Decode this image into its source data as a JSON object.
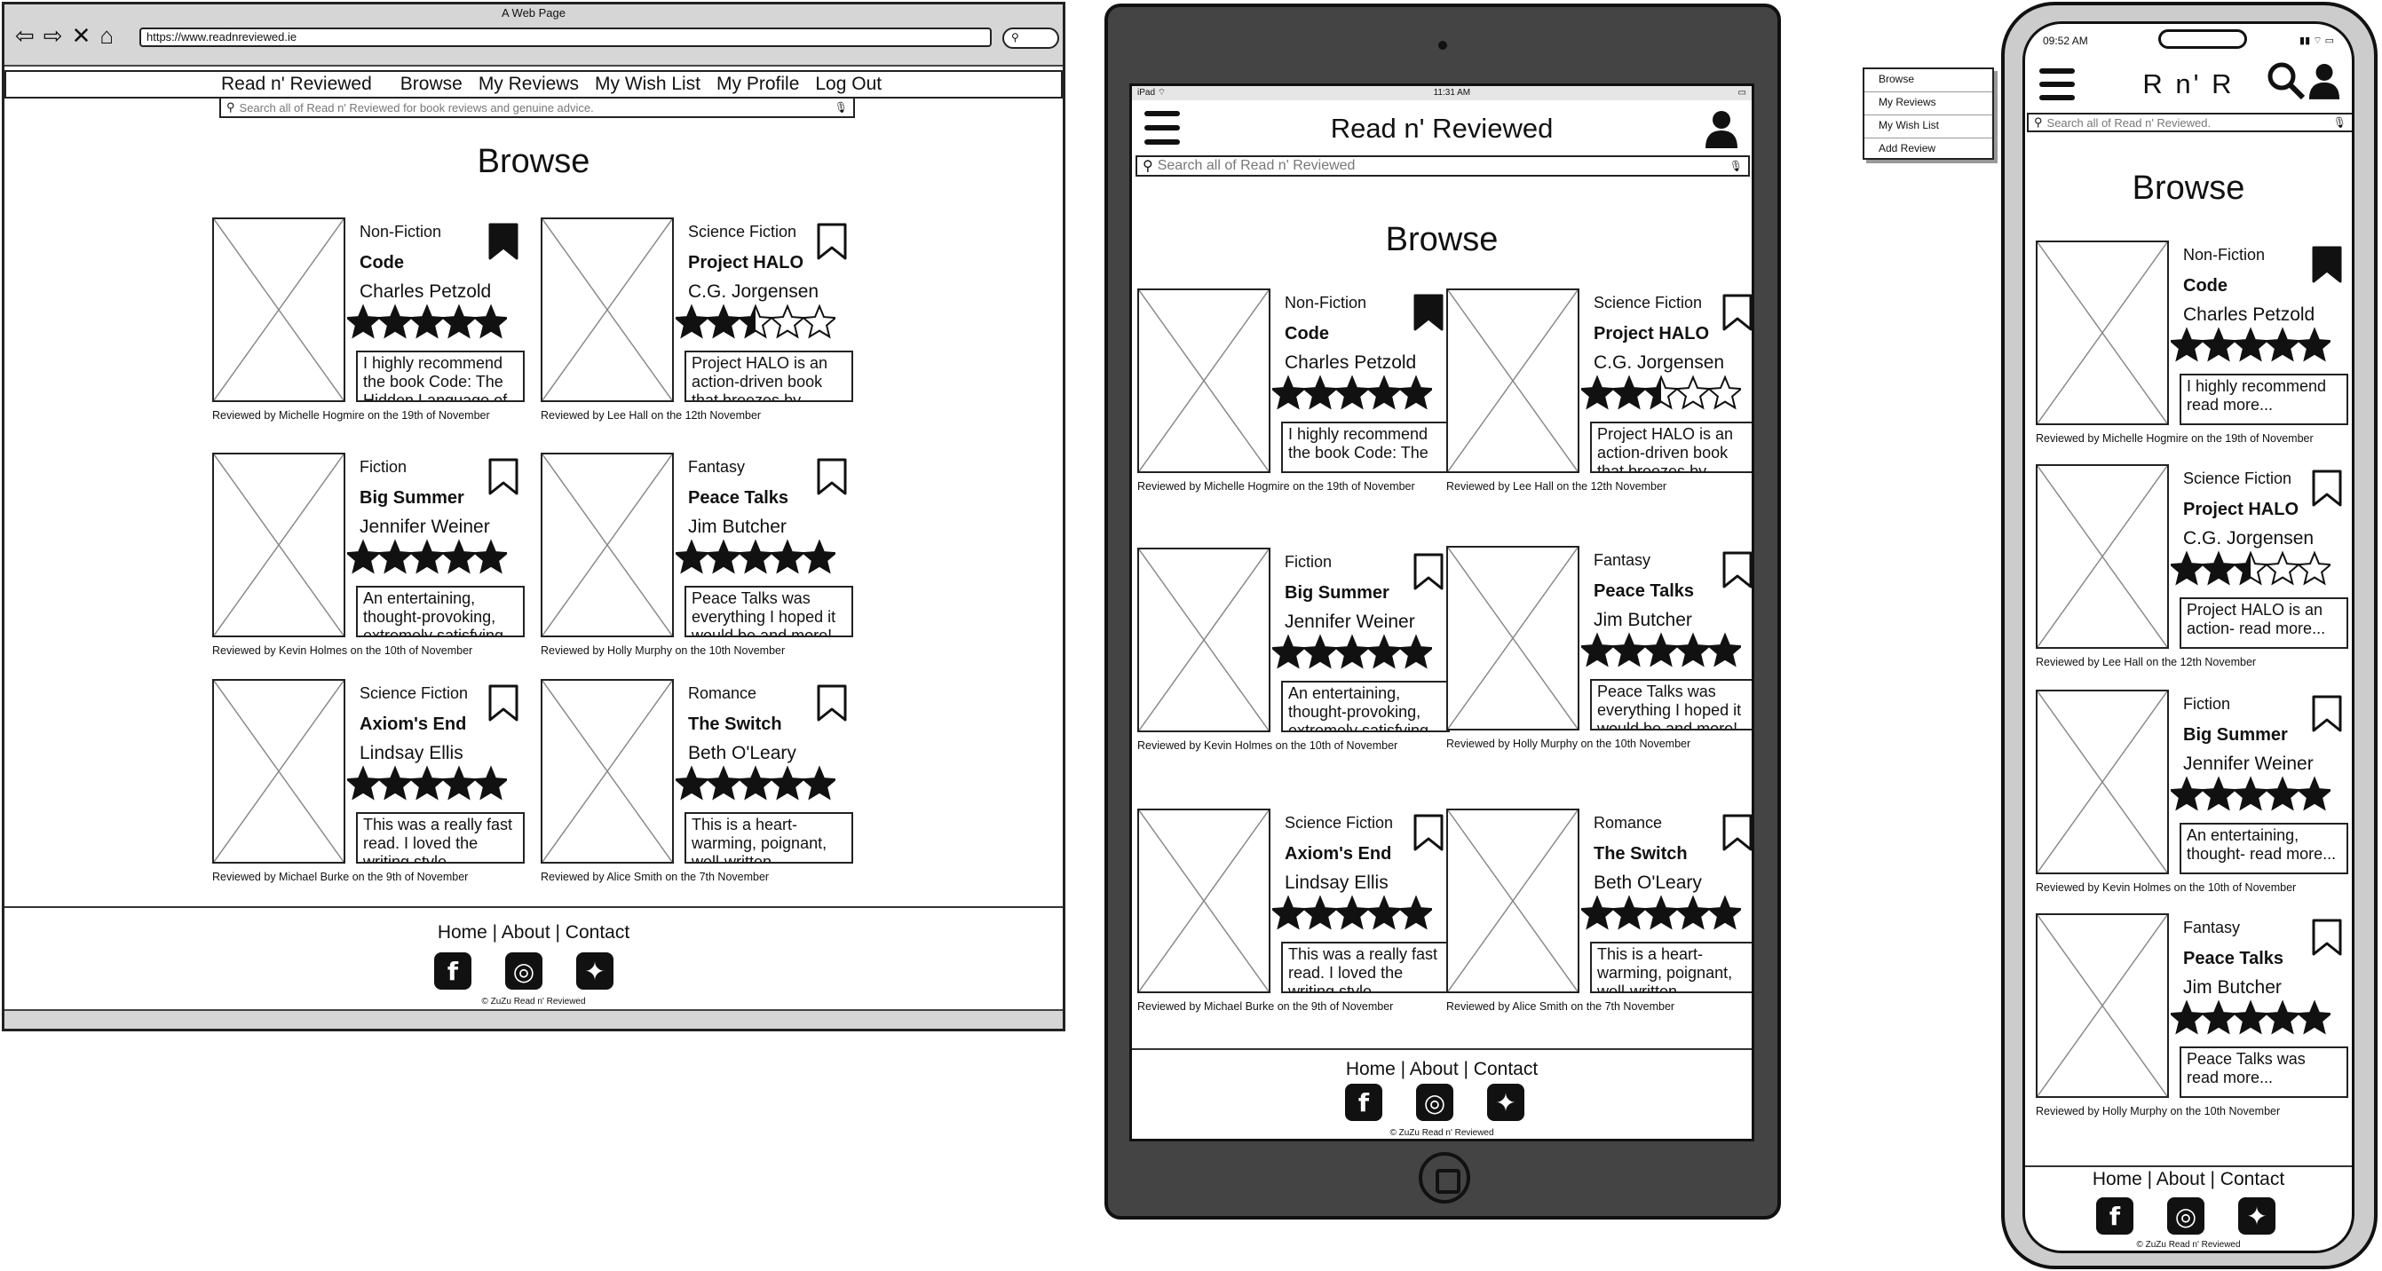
{
  "desktop": {
    "window_title": "A Web Page",
    "nav_buttons": [
      "⇦",
      "⇨",
      "✕",
      "⌂"
    ],
    "url": "https://www.readnreviewed.ie",
    "brand": "Read n' Reviewed",
    "nav_links": [
      "Browse",
      "My Reviews",
      "My Wish List",
      "My Profile",
      "Log Out"
    ],
    "search_placeholder": "Search all of Read n' Reviewed for book reviews and genuine advice.",
    "heading": "Browse",
    "cards": [
      {
        "genre": "Non-Fiction",
        "title": "Code",
        "author": "Charles Petzold",
        "rating": 5,
        "bookmarked": true,
        "review": "I highly recommend the book Code: The Hidden Language of",
        "byline": "Reviewed by Michelle Hogmire on the 19th of November"
      },
      {
        "genre": "Science Fiction",
        "title": "Project HALO",
        "author": "C.G. Jorgensen",
        "rating": 2.5,
        "bookmarked": false,
        "review": "Project HALO is an action-driven book that breezes by",
        "byline": "Reviewed by Lee Hall on the 12th November"
      },
      {
        "genre": "Fiction",
        "title": "Big Summer",
        "author": "Jennifer Weiner",
        "rating": 5,
        "bookmarked": false,
        "review": "An entertaining, thought-provoking, extremely satisfying",
        "byline": "Reviewed by Kevin Holmes on the 10th of November"
      },
      {
        "genre": "Fantasy",
        "title": "Peace Talks",
        "author": "Jim Butcher",
        "rating": 5,
        "bookmarked": false,
        "review": "Peace Talks was everything I hoped it would be and more!",
        "byline": "Reviewed by Holly Murphy on the 10th November"
      },
      {
        "genre": "Science Fiction",
        "title": "Axiom's End",
        "author": "Lindsay Ellis",
        "rating": 5,
        "bookmarked": false,
        "review": "This was a really fast read.  I loved the writing style",
        "byline": "Reviewed by Michael Burke on the 9th of November"
      },
      {
        "genre": "Romance",
        "title": "The Switch",
        "author": "Beth O'Leary",
        "rating": 5,
        "bookmarked": false,
        "review": "This is a heart-warming, poignant, well-written",
        "byline": "Reviewed by Alice Smith on the 7th November"
      }
    ],
    "footer_links": "Home  |  About  |  Contact",
    "copyright": "© ZuZu Read n' Reviewed"
  },
  "tablet": {
    "status_left": "iPad ⌔",
    "status_time": "11:31 AM",
    "status_right": "▭",
    "title": "Read n' Reviewed",
    "search_placeholder": "Search all of Read n' Reviewed",
    "heading": "Browse",
    "cards": [
      {
        "genre": "Non-Fiction",
        "title": "Code",
        "author": "Charles Petzold",
        "review": "I highly recommend the book Code: The",
        "byline": "Reviewed by Michelle Hogmire on the 19th of November"
      },
      {
        "genre": "Science Fiction",
        "title": "Project HALO",
        "author": "C.G. Jorgensen",
        "review": "Project HALO is an action-driven book that breezes by",
        "byline": "Reviewed by Lee Hall on the 12th November"
      },
      {
        "genre": "Fiction",
        "title": "Big Summer",
        "author": "Jennifer Weiner",
        "review": "An entertaining, thought-provoking, extremely satisfying",
        "byline": "Reviewed by Kevin Holmes on the 10th of November"
      },
      {
        "genre": "Fantasy",
        "title": "Peace Talks",
        "author": "Jim Butcher",
        "review": "Peace Talks was everything I hoped it would be and more!",
        "byline": "Reviewed by Holly Murphy on the 10th November"
      },
      {
        "genre": "Science Fiction",
        "title": "Axiom's End",
        "author": "Lindsay Ellis",
        "review": "This was a really fast read.  I loved the writing style",
        "byline": "Reviewed by Michael Burke on the 9th of November"
      },
      {
        "genre": "Romance",
        "title": "The Switch",
        "author": "Beth O'Leary",
        "review": "This is a heart-warming, poignant, well-written",
        "byline": "Reviewed by Alice Smith on the 7th November"
      }
    ],
    "footer_links": "Home  |  About  |  Contact",
    "copyright": "© ZuZu Read n' Reviewed"
  },
  "dropdown": [
    "Browse",
    "My Reviews",
    "My Wish List",
    "Add Review"
  ],
  "phone": {
    "status_time": "09:52 AM",
    "status_right": "▮▮ ⌔ ▭",
    "title": "R n' R",
    "search_placeholder": "Search all of Read n' Reviewed.",
    "heading": "Browse",
    "cards": [
      {
        "genre": "Non-Fiction",
        "title": "Code",
        "author": "Charles Petzold",
        "review": "I highly recommend read more...",
        "byline": "Reviewed by Michelle Hogmire on the 19th of November"
      },
      {
        "genre": "Science Fiction",
        "title": "Project HALO",
        "author": "C.G. Jorgensen",
        "review": "Project HALO is an action- read more...",
        "byline": "Reviewed by Lee Hall on the 12th November"
      },
      {
        "genre": "Fiction",
        "title": "Big Summer",
        "author": "Jennifer Weiner",
        "review": "An entertaining, thought- read more...",
        "byline": "Reviewed by Kevin Holmes on the 10th of November"
      },
      {
        "genre": "Fantasy",
        "title": "Peace Talks",
        "author": "Jim Butcher",
        "review": "Peace Talks was read more...",
        "byline": "Reviewed by Holly Murphy on the 10th November"
      }
    ],
    "footer_links": "Home  |  About  |  Contact",
    "copyright": "© ZuZu Read n' Reviewed"
  },
  "social_icons": [
    "facebook-icon",
    "instagram-icon",
    "twitter-icon"
  ]
}
